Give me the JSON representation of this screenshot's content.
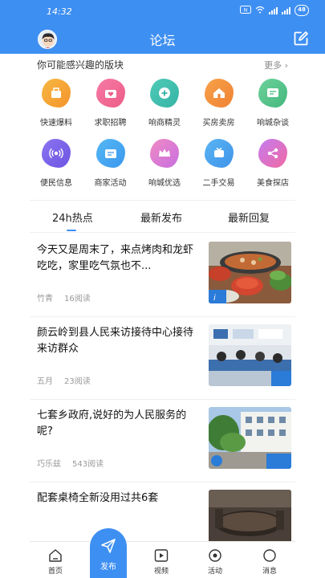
{
  "status": {
    "time": "14:32",
    "battery": "48"
  },
  "header": {
    "title": "论坛"
  },
  "section": {
    "title": "你可能感兴趣的版块",
    "more": "更多"
  },
  "categories": [
    {
      "label": "快速爆料",
      "icon": "megaphone-box-icon",
      "color": "#f7b742",
      "color2": "#f4942c"
    },
    {
      "label": "求职招聘",
      "icon": "briefcase-heart-icon",
      "color": "#f67aa6",
      "color2": "#ec5d86"
    },
    {
      "label": "响商精灵",
      "icon": "plus-circle-icon",
      "color": "#4ecbb6",
      "color2": "#36b3a6"
    },
    {
      "label": "买房卖房",
      "icon": "house-icon",
      "color": "#f7a24a",
      "color2": "#f08233"
    },
    {
      "label": "响城杂谈",
      "icon": "chat-screen-icon",
      "color": "#6cd29c",
      "color2": "#45b77c"
    },
    {
      "label": "便民信息",
      "icon": "broadcast-icon",
      "color": "#8a73f0",
      "color2": "#6d55e2"
    },
    {
      "label": "商家活动",
      "icon": "calendar-icon",
      "color": "#55b8f4",
      "color2": "#3a97ee"
    },
    {
      "label": "响城优选",
      "icon": "crown-icon",
      "color": "#f08ac4",
      "color2": "#c86fe0"
    },
    {
      "label": "二手交易",
      "icon": "exchange-icon",
      "color": "#5ab5f2",
      "color2": "#3f93ea"
    },
    {
      "label": "美食探店",
      "icon": "share-icon",
      "color": "#c47bf0",
      "color2": "#f06aa2"
    }
  ],
  "tabs": [
    "24h热点",
    "最新发布",
    "最新回复"
  ],
  "posts": [
    {
      "title": "今天又是周末了，来点烤肉和龙虾吃吃，家里吃气氛也不...",
      "author": "竹青",
      "reads": "16阅读",
      "thumb": "food"
    },
    {
      "title": "颜云岭到县人民来访接待中心接待来访群众",
      "author": "五月",
      "reads": "23阅读",
      "thumb": "meeting"
    },
    {
      "title": "七套乡政府,说好的为人民服务的呢?",
      "author": "巧乐兹",
      "reads": "543阅读",
      "thumb": "building"
    },
    {
      "title": "配套桌椅全新没用过共6套",
      "author": "",
      "reads": "",
      "thumb": "table"
    }
  ],
  "nav": {
    "home": "首页",
    "publish": "发布",
    "video": "视频",
    "activity": "活动",
    "message": "消息"
  },
  "colors": {
    "accent": "#3e8ff2"
  }
}
